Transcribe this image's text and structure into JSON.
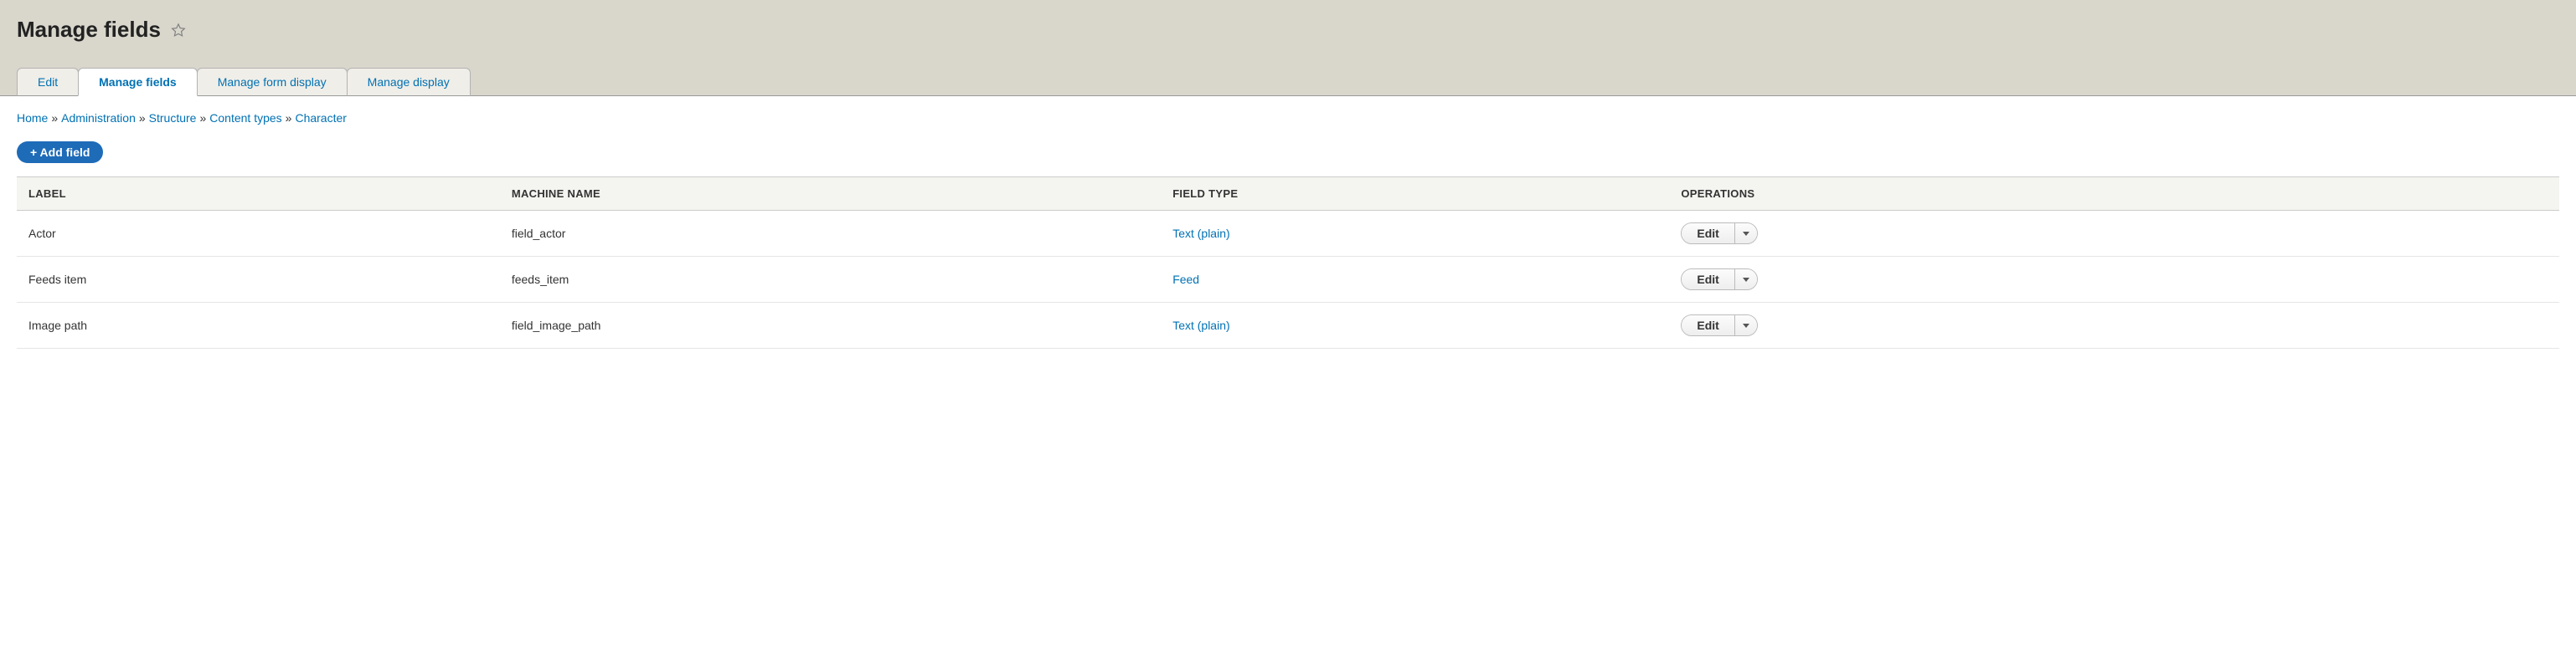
{
  "page_title": "Manage fields",
  "tabs": [
    {
      "label": "Edit"
    },
    {
      "label": "Manage fields"
    },
    {
      "label": "Manage form display"
    },
    {
      "label": "Manage display"
    }
  ],
  "active_tab": 1,
  "breadcrumb": [
    "Home",
    "Administration",
    "Structure",
    "Content types",
    "Character"
  ],
  "add_button_label": "+ Add field",
  "table": {
    "headers": {
      "label": "LABEL",
      "machine": "MACHINE NAME",
      "type": "FIELD TYPE",
      "ops": "OPERATIONS"
    },
    "rows": [
      {
        "label": "Actor",
        "machine": "field_actor",
        "type": "Text (plain)",
        "op": "Edit"
      },
      {
        "label": "Feeds item",
        "machine": "feeds_item",
        "type": "Feed",
        "op": "Edit"
      },
      {
        "label": "Image path",
        "machine": "field_image_path",
        "type": "Text (plain)",
        "op": "Edit"
      }
    ]
  }
}
